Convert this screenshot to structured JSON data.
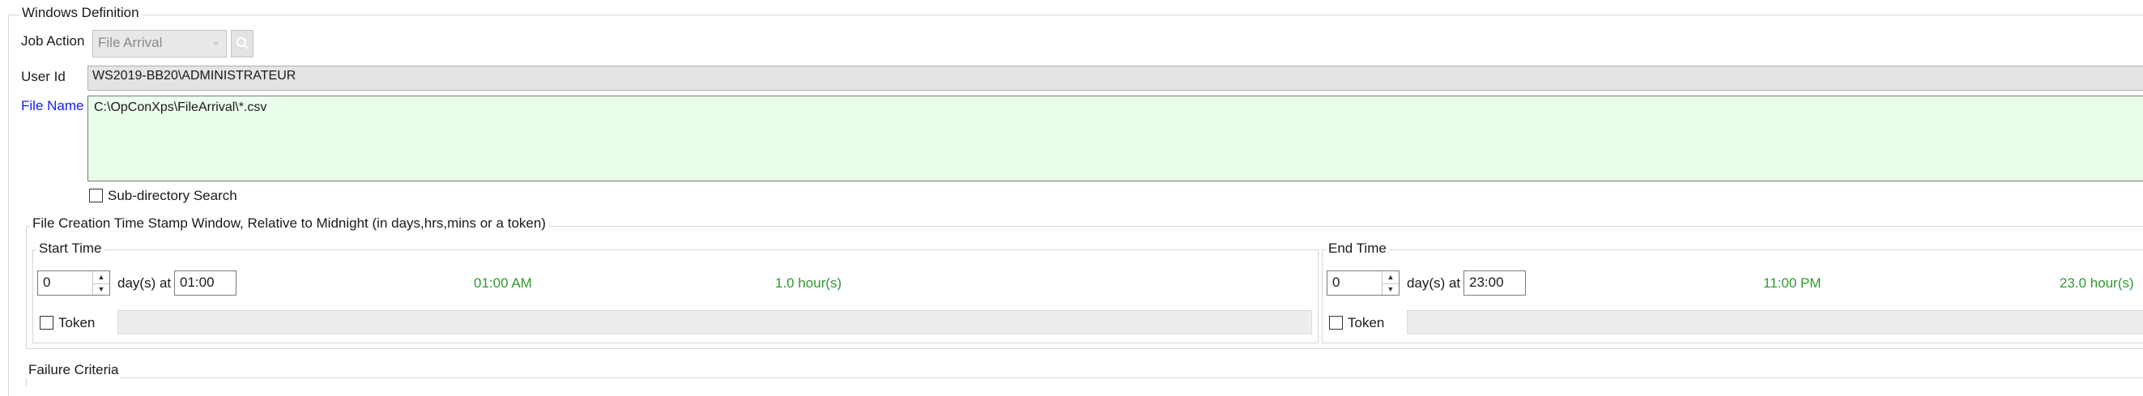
{
  "section": {
    "title": "Windows Definition"
  },
  "job_action": {
    "label": "Job Action",
    "value": "File Arrival",
    "icon": "search-icon"
  },
  "user_id": {
    "label": "User Id",
    "value": "WS2019-BB20\\ADMINISTRATEUR"
  },
  "file_name": {
    "label": "File Name",
    "value": "C:\\OpConXps\\FileArrival\\*.csv",
    "label_color": "#1a1aff"
  },
  "subdirectory": {
    "label": "Sub-directory Search",
    "checked": false
  },
  "window_group": {
    "title": "File Creation Time Stamp Window, Relative to Midnight (in days,hrs,mins or a token)"
  },
  "start_time": {
    "title": "Start Time",
    "days": "0",
    "days_at_label": "day(s) at",
    "time": "01:00",
    "display_time": "01:00 AM",
    "hours": "1.0 hour(s)",
    "token_label": "Token",
    "token_checked": false
  },
  "end_time": {
    "title": "End Time",
    "days": "0",
    "days_at_label": "day(s) at",
    "time": "23:00",
    "display_time": "11:00 PM",
    "hours": "23.0 hour(s)",
    "token_label": "Token",
    "token_checked": false
  },
  "failure_criteria": {
    "title": "Failure Criteria"
  },
  "colors": {
    "accent_green": "#2e9a2e",
    "file_field_bg": "#eafcea",
    "label_blue": "#1a1aff"
  }
}
